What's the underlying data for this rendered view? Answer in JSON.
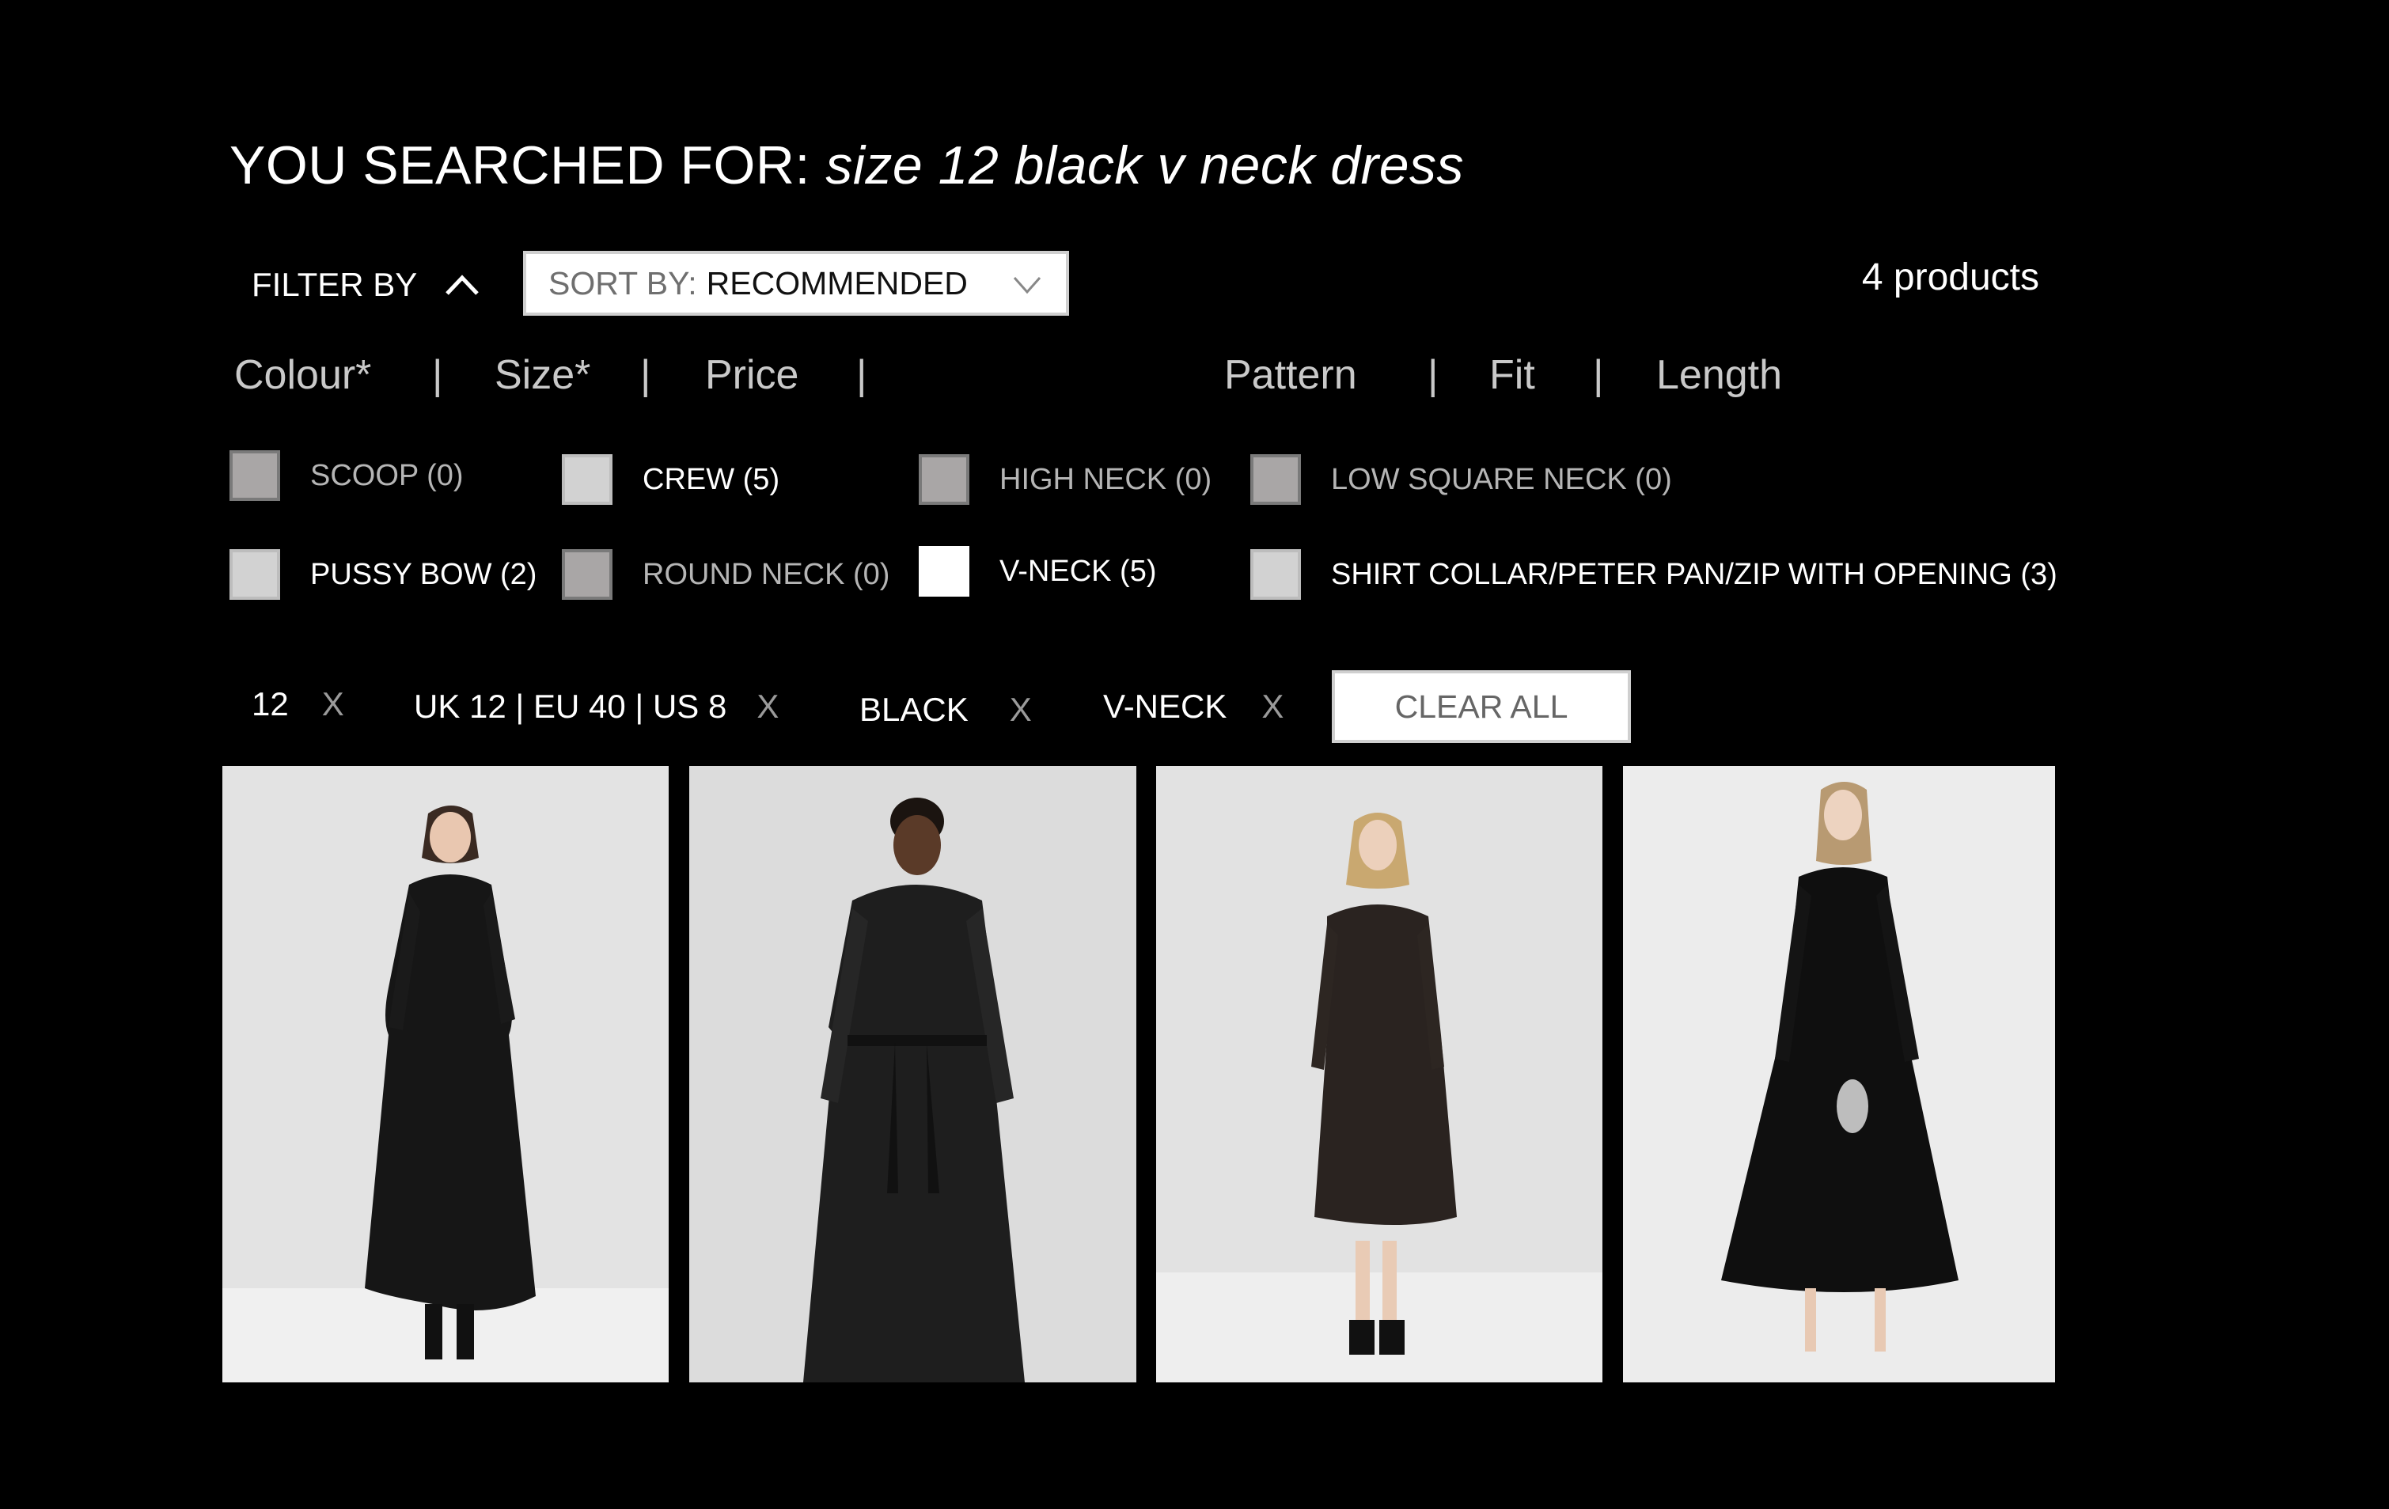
{
  "search": {
    "prefix": "YOU SEARCHED FOR:",
    "query": "size 12 black v neck dress"
  },
  "toolbar": {
    "filter_by_label": "FILTER BY",
    "sort_prefix": "SORT BY:",
    "sort_value": "RECOMMENDED",
    "product_count": "4 products"
  },
  "filter_tabs": {
    "items": [
      {
        "label": "Colour*"
      },
      {
        "label": "Size*"
      },
      {
        "label": "Price"
      },
      {
        "label": "Pattern"
      },
      {
        "label": "Fit"
      },
      {
        "label": "Length"
      }
    ],
    "separator": "|"
  },
  "neckline_options": [
    {
      "label": "SCOOP (0)",
      "state": "disabled"
    },
    {
      "label": "CREW (5)",
      "state": "enabled"
    },
    {
      "label": "HIGH NECK (0)",
      "state": "disabled"
    },
    {
      "label": "LOW SQUARE NECK (0)",
      "state": "disabled"
    },
    {
      "label": "PUSSY BOW (2)",
      "state": "enabled"
    },
    {
      "label": "ROUND NECK (0)",
      "state": "disabled"
    },
    {
      "label": "V-NECK (5)",
      "state": "checked"
    },
    {
      "label": "SHIRT COLLAR/PETER PAN/ZIP WITH OPENING (3)",
      "state": "enabled"
    }
  ],
  "active_filters": {
    "chips": [
      {
        "label": "12",
        "remove": "X"
      },
      {
        "label": "UK 12 | EU 40 | US 8",
        "remove": "X"
      },
      {
        "label": "BLACK",
        "remove": "X"
      },
      {
        "label": "V-NECK",
        "remove": "X"
      }
    ],
    "clear_all_label": "CLEAR ALL"
  },
  "products": [
    {
      "image": "black-midi-dress-model-photo"
    },
    {
      "image": "black-leather-dress-model-photo"
    },
    {
      "image": "black-print-wrap-dress-model-photo"
    },
    {
      "image": "black-wrap-midi-dress-model-photo"
    }
  ],
  "colors": {
    "background": "#000000",
    "text": "#ffffff",
    "muted_text": "#c9c9c9",
    "photo_bg": "#e2e2e2"
  }
}
